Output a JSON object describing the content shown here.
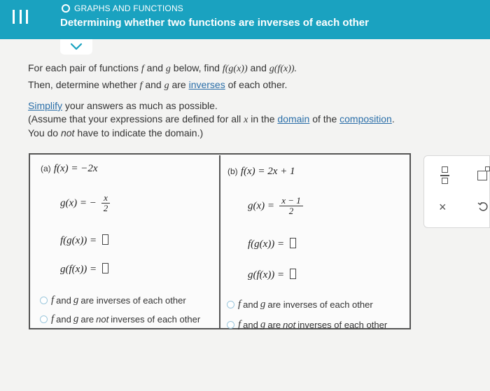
{
  "header": {
    "topic": "GRAPHS AND FUNCTIONS",
    "title": "Determining whether two functions are inverses of each other"
  },
  "instructions": {
    "line1_a": "For each pair of functions",
    "line1_f": "f",
    "line1_and": "and",
    "line1_g": "g",
    "line1_b": "below, find",
    "line1_fgx": "f(g(x))",
    "line1_and2": "and",
    "line1_gfx": "g(f(x)).",
    "line2_a": "Then, determine whether",
    "line2_f": "f",
    "line2_and": "and",
    "line2_g": "g",
    "line2_are": "are",
    "line2_link": "inverses",
    "line2_b": "of each other.",
    "simplify_link": "Simplify",
    "simplify_rest": "your answers as much as possible.",
    "assume_a": "(Assume that your expressions are defined for all",
    "assume_x": "x",
    "assume_in": "in the",
    "assume_link1": "domain",
    "assume_of": "of the",
    "assume_link2": "composition",
    "assume_end": ".",
    "domain_a": "You do",
    "domain_not": "not",
    "domain_b": "have to indicate the domain.)"
  },
  "part_a": {
    "label": "(a)",
    "f_def": "f(x) = −2x",
    "g_lhs": "g(x) = −",
    "g_num": "x",
    "g_den": "2",
    "fg": "f(g(x)) =",
    "gf": "g(f(x)) =",
    "opt1_mid": "are inverses of each other",
    "opt2_mid": "are",
    "opt2_not": "not",
    "opt2_end": "inverses of each other"
  },
  "part_b": {
    "label": "(b)",
    "f_def": "f(x) = 2x + 1",
    "g_lhs": "g(x) =",
    "g_num": "x − 1",
    "g_den": "2",
    "fg": "f(g(x)) =",
    "gf": "g(f(x)) =",
    "opt1_mid": "are inverses of each other",
    "opt2_mid": "are",
    "opt2_not": "not",
    "opt2_end": "inverses of each other"
  },
  "options_common": {
    "f": "f",
    "and": "and",
    "g": "g"
  },
  "tools": {
    "clear": "×"
  },
  "colors": {
    "header_bg": "#1aa2c0",
    "link": "#2a6ea8"
  }
}
